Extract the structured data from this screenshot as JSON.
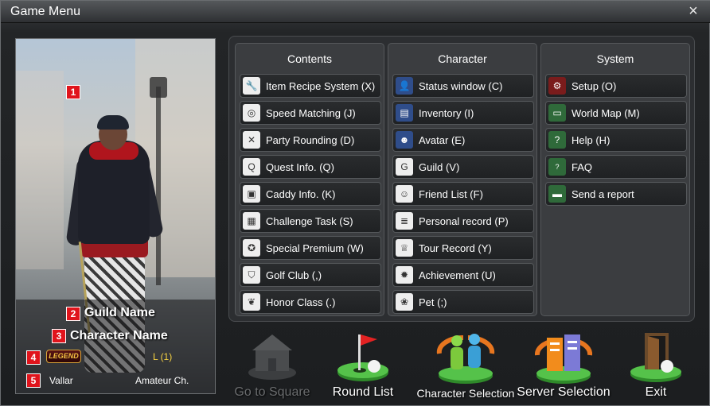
{
  "window": {
    "title": "Game Menu",
    "close_icon": "×"
  },
  "profile": {
    "markers": [
      "1",
      "2",
      "3",
      "4",
      "5"
    ],
    "guild_name": "Guild Name",
    "character_name": "Character Name",
    "badge": "LEGEND",
    "level": "L (1)",
    "currency": "Vallar",
    "rank": "Amateur Ch."
  },
  "columns": [
    {
      "title": "Contents",
      "items": [
        {
          "label": "Item Recipe System (X)",
          "icon": "wrench-icon"
        },
        {
          "label": "Speed Matching (J)",
          "icon": "speech-bubble-icon"
        },
        {
          "label": "Party Rounding (D)",
          "icon": "crossed-clubs-icon"
        },
        {
          "label": "Quest Info. (Q)",
          "icon": "q-icon"
        },
        {
          "label": "Caddy Info. (K)",
          "icon": "portrait-icon"
        },
        {
          "label": "Challenge Task (S)",
          "icon": "calendar-icon"
        },
        {
          "label": "Special Premium (W)",
          "icon": "premium-icon"
        },
        {
          "label": "Golf Club (,)",
          "icon": "club-emblem-icon"
        },
        {
          "label": "Honor Class (.)",
          "icon": "eagle-icon"
        }
      ]
    },
    {
      "title": "Character",
      "items": [
        {
          "label": "Status window (C)",
          "icon": "person-icon"
        },
        {
          "label": "Inventory (I)",
          "icon": "bag-icon"
        },
        {
          "label": "Avatar (E)",
          "icon": "avatar-icon"
        },
        {
          "label": "Guild (V)",
          "icon": "g-icon"
        },
        {
          "label": "Friend List (F)",
          "icon": "friends-icon"
        },
        {
          "label": "Personal record (P)",
          "icon": "clipboard-icon"
        },
        {
          "label": "Tour Record (Y)",
          "icon": "trophy-icon"
        },
        {
          "label": "Achievement (U)",
          "icon": "medal-icon"
        },
        {
          "label": "Pet (;)",
          "icon": "paw-icon"
        }
      ]
    },
    {
      "title": "System",
      "items": [
        {
          "label": "Setup (O)",
          "icon": "gear-icon"
        },
        {
          "label": "World Map (M)",
          "icon": "map-icon"
        },
        {
          "label": "Help (H)",
          "icon": "question-icon"
        },
        {
          "label": "FAQ",
          "icon": "faq-icon"
        },
        {
          "label": "Send a report",
          "icon": "monitor-icon"
        }
      ]
    }
  ],
  "bottom_buttons": [
    {
      "label": "Go to Square",
      "enabled": false,
      "icon": "house-icon"
    },
    {
      "label": "Round List",
      "enabled": true,
      "icon": "flag-green-icon"
    },
    {
      "label": "Character Selection",
      "enabled": true,
      "icon": "characters-icon"
    },
    {
      "label": "Server Selection",
      "enabled": true,
      "icon": "servers-icon"
    },
    {
      "label": "Exit",
      "enabled": true,
      "icon": "door-icon"
    }
  ]
}
